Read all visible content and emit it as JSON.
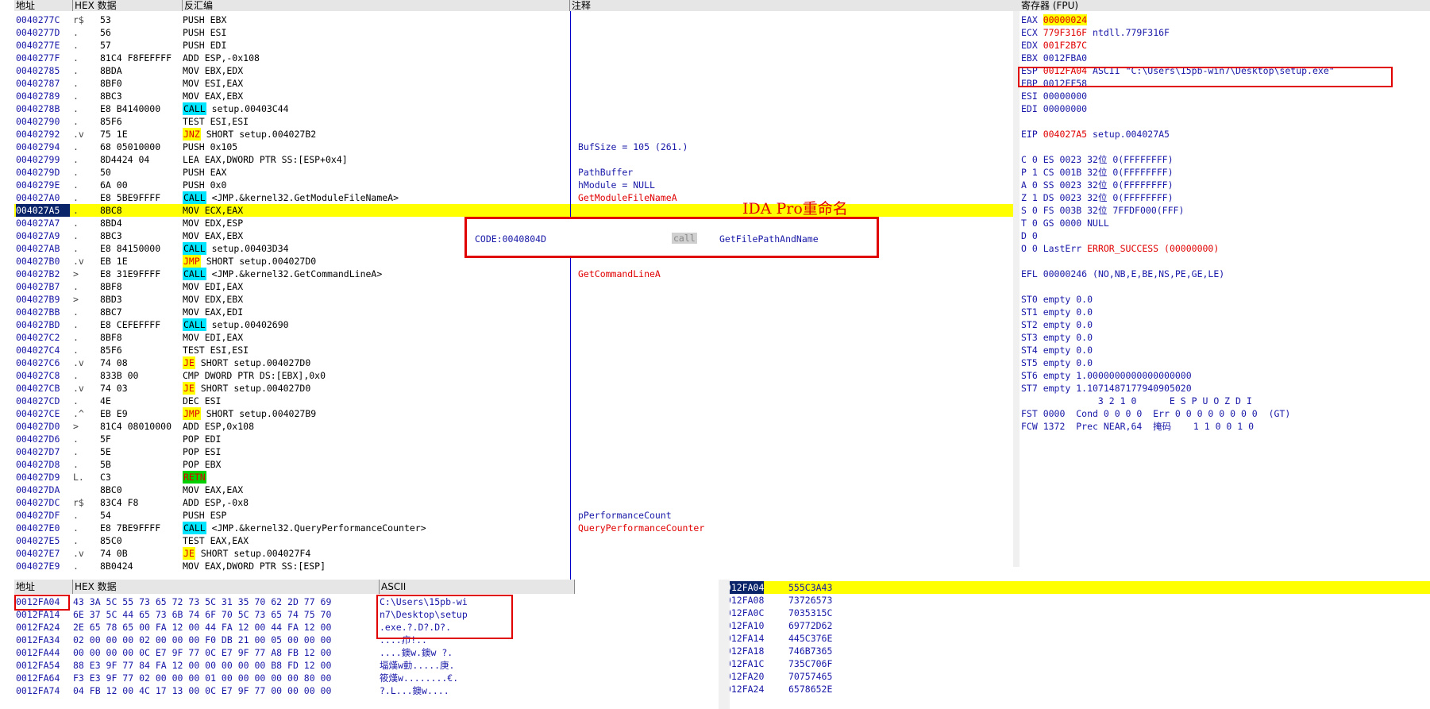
{
  "cpu": {
    "headers": [
      "地址",
      "HEX 数据",
      "反汇编",
      "注释"
    ],
    "rows": [
      {
        "addr": "0040277C",
        "mark": "r$",
        "hex": "53",
        "dis": "PUSH EBX",
        "com": ""
      },
      {
        "addr": "0040277D",
        "mark": ".",
        "hex": "56",
        "dis": "PUSH ESI",
        "com": ""
      },
      {
        "addr": "0040277E",
        "mark": ".",
        "hex": "57",
        "dis": "PUSH EDI",
        "com": ""
      },
      {
        "addr": "0040277F",
        "mark": ".",
        "hex": "81C4 F8FEFFFF",
        "dis": "ADD ESP,-0x108",
        "com": ""
      },
      {
        "addr": "00402785",
        "mark": ".",
        "hex": "8BDA",
        "dis": "MOV EBX,EDX",
        "com": ""
      },
      {
        "addr": "00402787",
        "mark": ".",
        "hex": "8BF0",
        "dis": "MOV ESI,EAX",
        "com": ""
      },
      {
        "addr": "00402789",
        "mark": ".",
        "hex": "8BC3",
        "dis": "MOV EAX,EBX",
        "com": ""
      },
      {
        "addr": "0040278B",
        "mark": ".",
        "hex": "E8 B4140000",
        "tag": "CALL",
        "tagType": "call",
        "dis": " setup.00403C44",
        "com": ""
      },
      {
        "addr": "00402790",
        "mark": ".",
        "hex": "85F6",
        "dis": "TEST ESI,ESI",
        "com": ""
      },
      {
        "addr": "00402792",
        "mark": ".v",
        "hex": "75 1E",
        "tag": "JNZ",
        "tagType": "jmp",
        "dis": " SHORT setup.004027B2",
        "com": ""
      },
      {
        "addr": "00402794",
        "mark": ".",
        "hex": "68 05010000",
        "dis": "PUSH 0x105",
        "com": "BufSize = 105 (261.)"
      },
      {
        "addr": "00402799",
        "mark": ".",
        "hex": "8D4424 04",
        "dis": "LEA EAX,DWORD PTR SS:[ESP+0x4]",
        "com": ""
      },
      {
        "addr": "0040279D",
        "mark": ".",
        "hex": "50",
        "dis": "PUSH EAX",
        "com": "PathBuffer"
      },
      {
        "addr": "0040279E",
        "mark": ".",
        "hex": "6A 00",
        "dis": "PUSH 0x0",
        "com": "hModule = NULL"
      },
      {
        "addr": "004027A0",
        "mark": ".",
        "hex": "E8 5BE9FFFF",
        "tag": "CALL",
        "tagType": "call",
        "dis": " <JMP.&kernel32.GetModuleFileNameA>",
        "com": "GetModuleFileNameA",
        "comRed": true
      },
      {
        "addr": "004027A5",
        "mark": ".",
        "hex": "8BC8",
        "dis": "MOV ECX,EAX",
        "com": "",
        "sel": true
      },
      {
        "addr": "004027A7",
        "mark": ".",
        "hex": "8BD4",
        "dis": "MOV EDX,ESP",
        "com": ""
      },
      {
        "addr": "004027A9",
        "mark": ".",
        "hex": "8BC3",
        "dis": "MOV EAX,EBX",
        "com": ""
      },
      {
        "addr": "004027AB",
        "mark": ".",
        "hex": "E8 84150000",
        "tag": "CALL",
        "tagType": "call",
        "dis": " setup.00403D34",
        "com": ""
      },
      {
        "addr": "004027B0",
        "mark": ".v",
        "hex": "EB 1E",
        "tag": "JMP",
        "tagType": "jmp",
        "dis": " SHORT setup.004027D0",
        "com": ""
      },
      {
        "addr": "004027B2",
        "mark": ">",
        "hex": "E8 31E9FFFF",
        "tag": "CALL",
        "tagType": "call",
        "dis": " <JMP.&kernel32.GetCommandLineA>",
        "com": "GetCommandLineA",
        "comRed": true
      },
      {
        "addr": "004027B7",
        "mark": ".",
        "hex": "8BF8",
        "dis": "MOV EDI,EAX",
        "com": ""
      },
      {
        "addr": "004027B9",
        "mark": ">",
        "hex": "8BD3",
        "dis": "MOV EDX,EBX",
        "com": ""
      },
      {
        "addr": "004027BB",
        "mark": ".",
        "hex": "8BC7",
        "dis": "MOV EAX,EDI",
        "com": ""
      },
      {
        "addr": "004027BD",
        "mark": ".",
        "hex": "E8 CEFEFFFF",
        "tag": "CALL",
        "tagType": "call",
        "dis": " setup.00402690",
        "com": ""
      },
      {
        "addr": "004027C2",
        "mark": ".",
        "hex": "8BF8",
        "dis": "MOV EDI,EAX",
        "com": ""
      },
      {
        "addr": "004027C4",
        "mark": ".",
        "hex": "85F6",
        "dis": "TEST ESI,ESI",
        "com": ""
      },
      {
        "addr": "004027C6",
        "mark": ".v",
        "hex": "74 08",
        "tag": "JE",
        "tagType": "jmp",
        "dis": " SHORT setup.004027D0",
        "com": ""
      },
      {
        "addr": "004027C8",
        "mark": ".",
        "hex": "833B 00",
        "dis": "CMP DWORD PTR DS:[EBX],0x0",
        "com": ""
      },
      {
        "addr": "004027CB",
        "mark": ".v",
        "hex": "74 03",
        "tag": "JE",
        "tagType": "jmp",
        "dis": " SHORT setup.004027D0",
        "com": ""
      },
      {
        "addr": "004027CD",
        "mark": ".",
        "hex": "4E",
        "dis": "DEC ESI",
        "com": ""
      },
      {
        "addr": "004027CE",
        "mark": ".^",
        "hex": "EB E9",
        "tag": "JMP",
        "tagType": "jmp",
        "dis": " SHORT setup.004027B9",
        "com": ""
      },
      {
        "addr": "004027D0",
        "mark": ">",
        "hex": "81C4 08010000",
        "dis": "ADD ESP,0x108",
        "com": ""
      },
      {
        "addr": "004027D6",
        "mark": ".",
        "hex": "5F",
        "dis": "POP EDI",
        "com": ""
      },
      {
        "addr": "004027D7",
        "mark": ".",
        "hex": "5E",
        "dis": "POP ESI",
        "com": ""
      },
      {
        "addr": "004027D8",
        "mark": ".",
        "hex": "5B",
        "dis": "POP EBX",
        "com": ""
      },
      {
        "addr": "004027D9",
        "mark": "L.",
        "hex": "C3",
        "tag": "RETN",
        "tagType": "retn",
        "dis": "",
        "com": ""
      },
      {
        "addr": "004027DA",
        "mark": "",
        "hex": "8BC0",
        "dis": "MOV EAX,EAX",
        "com": ""
      },
      {
        "addr": "004027DC",
        "mark": "r$",
        "hex": "83C4 F8",
        "dis": "ADD ESP,-0x8",
        "com": ""
      },
      {
        "addr": "004027DF",
        "mark": ".",
        "hex": "54",
        "dis": "PUSH ESP",
        "com": "pPerformanceCount"
      },
      {
        "addr": "004027E0",
        "mark": ".",
        "hex": "E8 7BE9FFFF",
        "tag": "CALL",
        "tagType": "call",
        "dis": " <JMP.&kernel32.QueryPerformanceCounter>",
        "com": "QueryPerformanceCounter",
        "comRed": true
      },
      {
        "addr": "004027E5",
        "mark": ".",
        "hex": "85C0",
        "dis": "TEST EAX,EAX",
        "com": ""
      },
      {
        "addr": "004027E7",
        "mark": ".v",
        "hex": "74 0B",
        "tag": "JE",
        "tagType": "jmp",
        "dis": " SHORT setup.004027F4",
        "com": ""
      },
      {
        "addr": "004027E9",
        "mark": ".",
        "hex": "8B0424",
        "dis": "MOV EAX,DWORD PTR SS:[ESP]",
        "com": ""
      }
    ]
  },
  "ida": {
    "label": "IDA Pro重命名",
    "addr": "CODE:0040804D",
    "op": "call",
    "target": "GetFilePathAndName"
  },
  "registers": {
    "title": "寄存器 (FPU)",
    "rows": [
      {
        "name": "EAX",
        "val": "00000024",
        "extra": "",
        "style": "hl"
      },
      {
        "name": "ECX",
        "val": "779F316F",
        "extra": "ntdll.779F316F",
        "style": "red"
      },
      {
        "name": "EDX",
        "val": "001F2B7C",
        "extra": "",
        "style": "red"
      },
      {
        "name": "EBX",
        "val": "0012FBA0",
        "extra": "",
        "style": ""
      },
      {
        "name": "ESP",
        "val": "0012FA04",
        "extra": "ASCII \"C:\\Users\\15pb-win7\\Desktop\\setup.exe\"",
        "style": "red"
      },
      {
        "name": "EBP",
        "val": "0012FF58",
        "extra": "",
        "style": ""
      },
      {
        "name": "ESI",
        "val": "00000000",
        "extra": "",
        "style": ""
      },
      {
        "name": "EDI",
        "val": "00000000",
        "extra": "",
        "style": ""
      },
      {
        "name": "",
        "val": "",
        "extra": "",
        "style": ""
      },
      {
        "name": "EIP",
        "val": "004027A5",
        "extra": "setup.004027A5",
        "style": "red"
      },
      {
        "name": "",
        "val": "",
        "extra": "",
        "style": ""
      },
      {
        "name": "C 0",
        "val": "",
        "extra": "ES 0023 32位 0(FFFFFFFF)",
        "style": ""
      },
      {
        "name": "P 1",
        "val": "",
        "extra": "CS 001B 32位 0(FFFFFFFF)",
        "style": ""
      },
      {
        "name": "A 0",
        "val": "",
        "extra": "SS 0023 32位 0(FFFFFFFF)",
        "style": ""
      },
      {
        "name": "Z 1",
        "val": "",
        "extra": "DS 0023 32位 0(FFFFFFFF)",
        "style": ""
      },
      {
        "name": "S 0",
        "val": "",
        "extra": "FS 003B 32位 7FFDF000(FFF)",
        "style": ""
      },
      {
        "name": "T 0",
        "val": "",
        "extra": "GS 0000 NULL",
        "style": ""
      },
      {
        "name": "D 0",
        "val": "",
        "extra": "",
        "style": ""
      },
      {
        "name": "O 0",
        "val": "",
        "extra": "LastErr ERROR_SUCCESS (00000000)",
        "style": "lasterr"
      },
      {
        "name": "",
        "val": "",
        "extra": "",
        "style": ""
      },
      {
        "name": "EFL",
        "val": "",
        "extra": "00000246 (NO,NB,E,BE,NS,PE,GE,LE)",
        "style": ""
      },
      {
        "name": "",
        "val": "",
        "extra": "",
        "style": ""
      },
      {
        "name": "ST0",
        "val": "",
        "extra": "empty 0.0",
        "style": ""
      },
      {
        "name": "ST1",
        "val": "",
        "extra": "empty 0.0",
        "style": ""
      },
      {
        "name": "ST2",
        "val": "",
        "extra": "empty 0.0",
        "style": ""
      },
      {
        "name": "ST3",
        "val": "",
        "extra": "empty 0.0",
        "style": ""
      },
      {
        "name": "ST4",
        "val": "",
        "extra": "empty 0.0",
        "style": ""
      },
      {
        "name": "ST5",
        "val": "",
        "extra": "empty 0.0",
        "style": ""
      },
      {
        "name": "ST6",
        "val": "",
        "extra": "empty 1.0000000000000000000",
        "style": ""
      },
      {
        "name": "ST7",
        "val": "",
        "extra": "empty 1.1071487177940905020",
        "style": ""
      },
      {
        "name": "",
        "val": "",
        "extra": "              3 2 1 0      E S P U O Z D I",
        "style": ""
      },
      {
        "name": "FST",
        "val": "",
        "extra": "0000  Cond 0 0 0 0  Err 0 0 0 0 0 0 0 0  (GT)",
        "style": ""
      },
      {
        "name": "FCW",
        "val": "",
        "extra": "1372  Prec NEAR,64  掩码    1 1 0 0 1 0",
        "style": ""
      }
    ]
  },
  "dump": {
    "headers": [
      "地址",
      "HEX 数据",
      "ASCII"
    ],
    "rows": [
      {
        "addr": "0012FA04",
        "hex": "43 3A 5C 55 73 65 72 73 5C 31 35 70 62 2D 77 69",
        "asc": "C:\\Users\\15pb-wi"
      },
      {
        "addr": "0012FA14",
        "hex": "6E 37 5C 44 65 73 6B 74 6F 70 5C 73 65 74 75 70",
        "asc": "n7\\Desktop\\setup"
      },
      {
        "addr": "0012FA24",
        "hex": "2E 65 78 65 00 FA 12 00 44 FA 12 00 44 FA 12 00",
        "asc": ".exe.?.D?.D?."
      },
      {
        "addr": "0012FA34",
        "hex": "02 00 00 00 02 00 00 00 F0 DB 21 00 05 00 00 00",
        "asc": "....疖!.."
      },
      {
        "addr": "0012FA44",
        "hex": "00 00 00 00 0C E7 9F 77 0C E7 9F 77 A8 FB 12 00",
        "asc": "....鐭w.鐭w ?."
      },
      {
        "addr": "0012FA54",
        "hex": "88 E3 9F 77 84 FA 12 00 00 00 00 00 B8 FD 12 00",
        "asc": "堛熯w勭.....庚."
      },
      {
        "addr": "0012FA64",
        "hex": "F3 E3 9F 77 02 00 00 00 01 00 00 00 00 00 80 00",
        "asc": "筱熯w........€."
      },
      {
        "addr": "0012FA74",
        "hex": "04 FB 12 00 4C 17 13 00 0C E7 9F 77 00 00 00 00",
        "asc": "?.L...鐭w...."
      }
    ]
  },
  "stack": {
    "rows": [
      {
        "addr": "0012FA04",
        "val": "555C3A43",
        "sel": true
      },
      {
        "addr": "0012FA08",
        "val": "73726573"
      },
      {
        "addr": "0012FA0C",
        "val": "7035315C"
      },
      {
        "addr": "0012FA10",
        "val": "69772D62"
      },
      {
        "addr": "0012FA14",
        "val": "445C376E"
      },
      {
        "addr": "0012FA18",
        "val": "746B7365"
      },
      {
        "addr": "0012FA1C",
        "val": "735C706F"
      },
      {
        "addr": "0012FA20",
        "val": "70757465"
      },
      {
        "addr": "0012FA24",
        "val": "6578652E"
      }
    ]
  }
}
